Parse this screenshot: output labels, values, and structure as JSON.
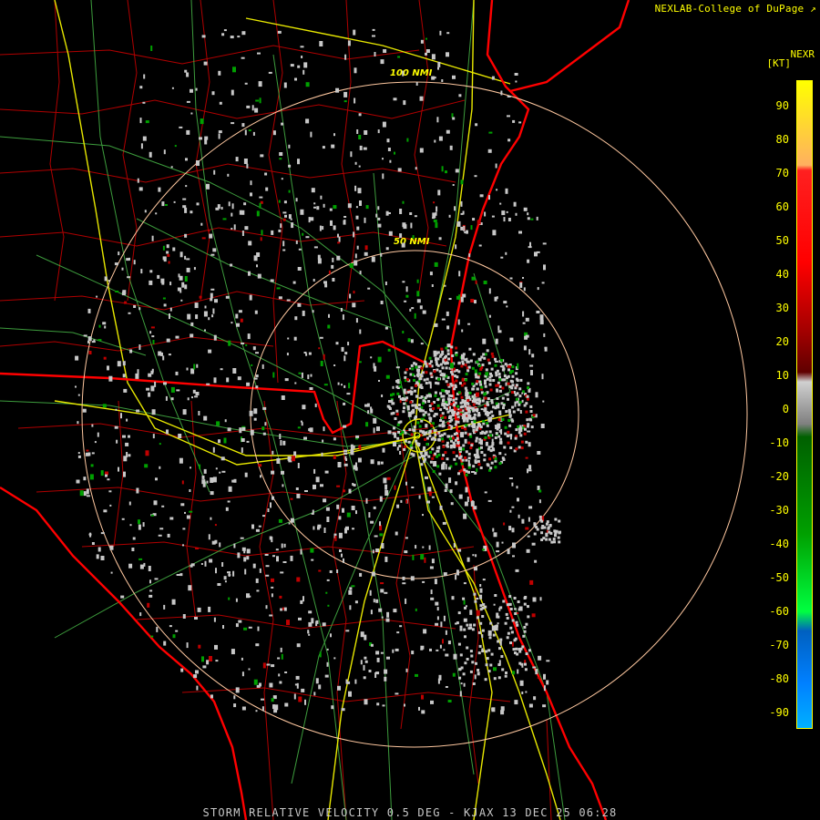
{
  "header": {
    "credit": "NEXLAB-College of DuPage",
    "credit_icon": "cursor-arrow-icon",
    "product": "NEXR",
    "units": "[KT]"
  },
  "colorbar": {
    "ticks": [
      "90",
      "80",
      "70",
      "60",
      "50",
      "40",
      "30",
      "20",
      "10",
      "0",
      "-10",
      "-20",
      "-30",
      "-40",
      "-50",
      "-60",
      "-70",
      "-80",
      "-90"
    ]
  },
  "range_rings": {
    "inner": "50 NMI",
    "outer": "100 NMI"
  },
  "footer": {
    "title": "STORM RELATIVE VELOCITY 0.5 DEG - KJAX 13 DEC 25 06:28"
  },
  "colors": {
    "coast": "#ff0000",
    "county": "#c00000",
    "highway": "#ffff00",
    "roads": "#50c050",
    "rings": "#ffc8a0",
    "echo_gray": "#c8c8c8",
    "echo_green": "#00a000",
    "echo_red": "#c00000"
  }
}
